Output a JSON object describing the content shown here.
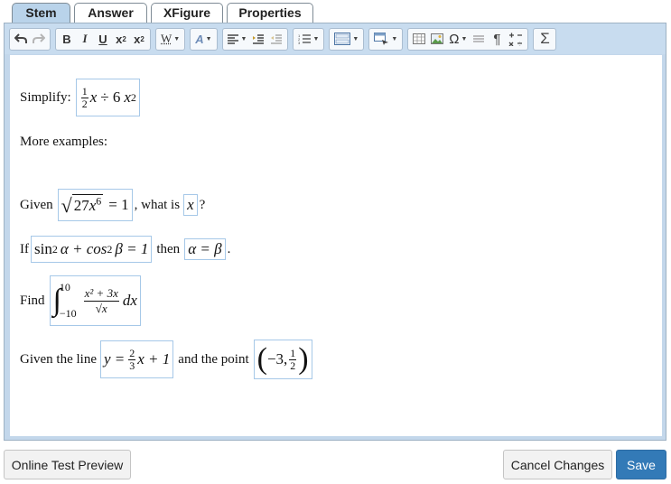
{
  "tabs": [
    {
      "label": "Stem",
      "active": true
    },
    {
      "label": "Answer",
      "active": false
    },
    {
      "label": "XFigure",
      "active": false
    },
    {
      "label": "Properties",
      "active": false
    }
  ],
  "toolbar": {
    "undo_icon": "undo-arrow",
    "redo_icon": "redo-arrow",
    "bold": "B",
    "italic": "I",
    "underline": "U",
    "subscript": "x",
    "subscript_mark": "2",
    "superscript": "x",
    "superscript_mark": "2",
    "font_family": "W",
    "font_color_icon": "font-color",
    "align_icon": "align-left",
    "indent_icon": "indent",
    "outdent_icon": "outdent",
    "list_icon": "numbered-list",
    "template_icon": "part-template",
    "insert_icon": "insert-box",
    "table_icon": "table",
    "image_icon": "image",
    "special_char": "Ω",
    "hr_icon": "horizontal-line",
    "paragraph": "¶",
    "math_ops_icon": "math-operators",
    "sigma": "Σ"
  },
  "content": {
    "simplify": "Simplify:",
    "frac_one": "1",
    "frac_two": "2",
    "x": "x",
    "div_expr": "÷ 6",
    "x_var": "x",
    "exp2": "2",
    "more_examples": "More examples:",
    "given": "Given",
    "sqrt_arg": "27",
    "sqrt_x": "x",
    "exp6": "6",
    "eq_one": "= 1",
    "what_is": ", what is",
    "what_x": "x",
    "qmark": "?",
    "if": "If",
    "sin": "sin",
    "alpha_term": "α + cos",
    "beta_term": "β = 1",
    "then": "then",
    "alpha_eq_beta": "α = β",
    "period": ".",
    "find": "Find",
    "int_upper": "10",
    "int_lower": "−10",
    "int_num": "x² + 3x",
    "int_den_x": "x",
    "dx": "dx",
    "given_line": "Given the line",
    "y_eq": "y =",
    "slope_num": "2",
    "slope_den": "3",
    "x_plus_one": "x + 1",
    "and_point": "and the point",
    "point_x": "−3,",
    "point_num": "1",
    "point_den": "2"
  },
  "buttons": {
    "preview": "Online Test Preview",
    "cancel": "Cancel Changes",
    "save": "Save"
  },
  "colors": {
    "active_tab": "#b9d3ea",
    "toolbar_bg": "#c8dcef",
    "math_border": "#a6c8e8",
    "save_button": "#337ab7"
  }
}
